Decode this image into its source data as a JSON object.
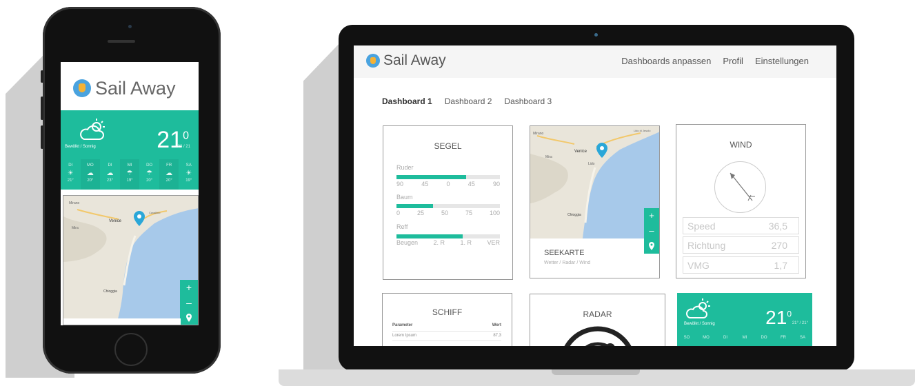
{
  "phone": {
    "app_name": "Sail Away",
    "weather": {
      "temperature": "21",
      "unit_sup": "0",
      "range": "23 / 21",
      "condition": "Bewölkt / Sonnig",
      "days": [
        {
          "day": "DI",
          "temp": "21°",
          "icon": "sun-icon"
        },
        {
          "day": "MO",
          "temp": "20°",
          "icon": "cloud-icon"
        },
        {
          "day": "DI",
          "temp": "23°",
          "icon": "cloud-icon"
        },
        {
          "day": "MI",
          "temp": "19°",
          "icon": "rain-icon"
        },
        {
          "day": "DO",
          "temp": "20°",
          "icon": "rain-icon"
        },
        {
          "day": "FR",
          "temp": "20°",
          "icon": "cloud-icon"
        },
        {
          "day": "SA",
          "temp": "19°",
          "icon": "sun-icon"
        }
      ]
    },
    "map": {
      "place_labels": [
        "Mirano",
        "Mira",
        "Venice",
        "Chioggia",
        "Cavallino"
      ],
      "zoom_in": "+",
      "zoom_out": "–"
    }
  },
  "laptop": {
    "app_name": "Sail Away",
    "nav": [
      "Dashboards anpassen",
      "Profil",
      "Einstellungen"
    ],
    "tabs": [
      "Dashboard 1",
      "Dashboard 2",
      "Dashboard 3"
    ],
    "active_tab": "Dashboard 1",
    "segel": {
      "title": "SEGEL",
      "sliders": [
        {
          "label": "Ruder",
          "fill": 0.67,
          "ticks": [
            "90",
            "45",
            "0",
            "45",
            "90"
          ]
        },
        {
          "label": "Baum",
          "fill": 0.35,
          "ticks": [
            "0",
            "25",
            "50",
            "75",
            "100"
          ]
        },
        {
          "label": "Reff",
          "fill": 0.64,
          "ticks": [
            "Beugen",
            "2. R",
            "1. R",
            "VER"
          ]
        }
      ]
    },
    "seekarte": {
      "title": "SEEKARTE",
      "subtitle": "Wetter / Radar / Wind",
      "place_labels": [
        "Mirano",
        "Venice",
        "Mira",
        "Lido",
        "Chioggia",
        "Lido di Jesolo"
      ],
      "zoom_in": "+",
      "zoom_out": "–"
    },
    "wind": {
      "title": "WIND",
      "rows": [
        {
          "label": "Speed",
          "value": "36,5"
        },
        {
          "label": "Richtung",
          "value": "270"
        },
        {
          "label": "VMG",
          "value": "1,7"
        }
      ]
    },
    "schiff": {
      "title": "SCHIFF",
      "columns": [
        "Parameter",
        "Wert"
      ],
      "rows": [
        {
          "param": "Lorem Ipsum",
          "value": "87,3"
        },
        {
          "param": "",
          "value": ""
        }
      ]
    },
    "radar": {
      "title": "RADAR"
    },
    "weather": {
      "temperature": "21",
      "unit_sup": "0",
      "range": "21° / 21°",
      "condition": "Bewölkt / Sonnig",
      "days": [
        "SO",
        "MO",
        "DI",
        "MI",
        "DO",
        "FR",
        "SA"
      ]
    }
  },
  "colors": {
    "accent": "#1ebc9c",
    "map_water": "#a7c9ea",
    "logo_blue": "#4aa3df",
    "logo_yellow": "#f5b234"
  }
}
